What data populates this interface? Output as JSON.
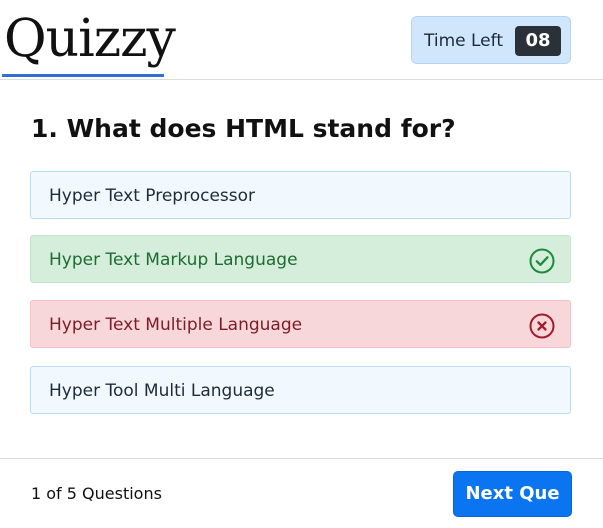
{
  "header": {
    "logo": "Quizzy",
    "timer_label": "Time Left",
    "timer_value": "08"
  },
  "question": {
    "text": "1. What does HTML stand for?"
  },
  "options": [
    {
      "label": "Hyper Text Preprocessor",
      "state": "default"
    },
    {
      "label": "Hyper Text Markup Language",
      "state": "correct"
    },
    {
      "label": "Hyper Text Multiple Language",
      "state": "wrong"
    },
    {
      "label": "Hyper Tool Multi Language",
      "state": "default"
    }
  ],
  "footer": {
    "question_count": "1 of 5 Questions",
    "next_label": "Next Que"
  },
  "colors": {
    "accent": "#0b74f0",
    "correct": "#1f8a3a",
    "wrong": "#a11d2a",
    "timer_bg": "#cfe6fb"
  },
  "icons": {
    "correct": "check-circle-icon",
    "wrong": "x-circle-icon"
  }
}
